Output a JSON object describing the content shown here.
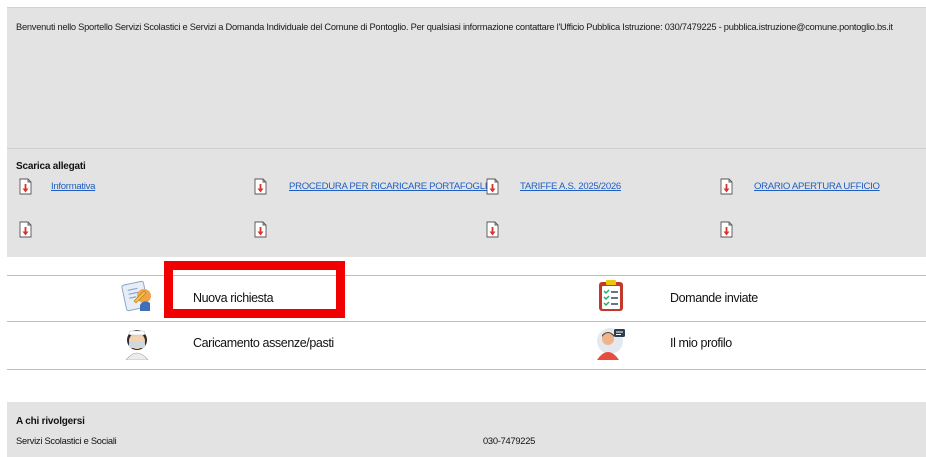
{
  "welcome": {
    "text": "Benvenuti nello Sportello Servizi Scolastici e Servizi a Domanda Individuale del Comune di Pontoglio. Per qualsiasi informazione contattare l'Ufficio Pubblica Istruzione: 030/7479225 - pubblica.istruzione@comune.pontoglio.bs.it"
  },
  "attachments": {
    "title": "Scarica allegati",
    "icon": "pdf-file-icon",
    "items": [
      {
        "label": "Informativa"
      },
      {
        "label": "PROCEDURA PER RICARICARE PORTAFOGLIO"
      },
      {
        "label": "TARIFFE A.S. 2025/2026"
      },
      {
        "label": "ORARIO APERTURA UFFICIO"
      },
      {
        "label": ""
      },
      {
        "label": ""
      },
      {
        "label": ""
      },
      {
        "label": ""
      }
    ]
  },
  "menu": {
    "items": [
      {
        "label": "Nuova richiesta",
        "icon": "new-request-icon"
      },
      {
        "label": "Domande inviate",
        "icon": "sent-requests-icon"
      },
      {
        "label": "Caricamento assenze/pasti",
        "icon": "absences-meals-icon"
      },
      {
        "label": "Il mio profilo",
        "icon": "profile-icon"
      }
    ],
    "highlight_color": "#f00000"
  },
  "contacts": {
    "title": "A chi rivolgersi",
    "name": "Servizi Scolastici e Sociali",
    "phone": "030-7479225"
  },
  "colors": {
    "panel_bg": "#e3e3e3",
    "link": "#1f5fc4",
    "pdf_red": "#d6342c"
  }
}
